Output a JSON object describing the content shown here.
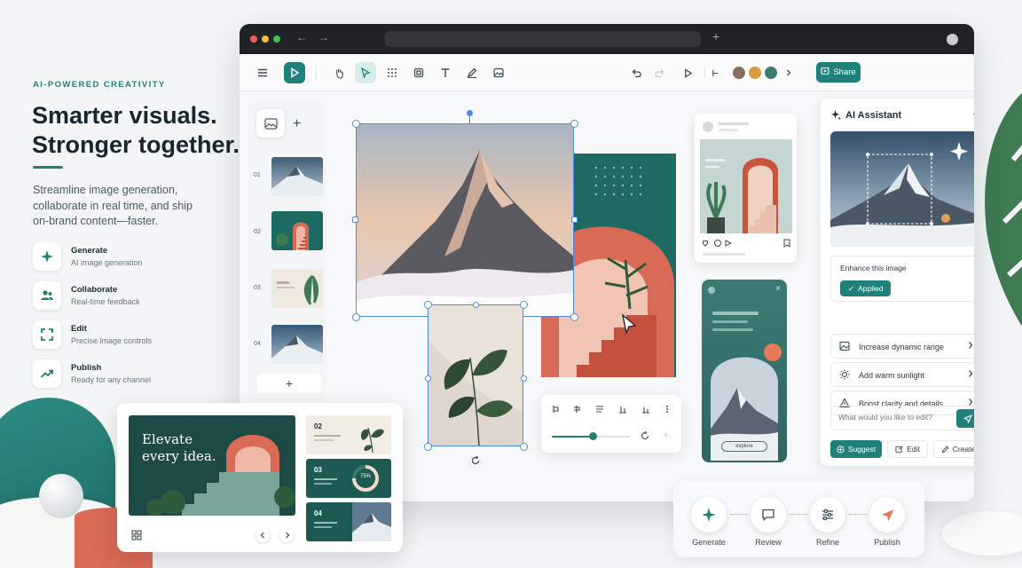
{
  "hero": {
    "eyebrow": "AI-POWERED CREATIVITY",
    "title_line1": "Smarter visuals.",
    "title_line2": "Stronger together.",
    "subtitle": "Streamline image generation, collaborate in real time, and ship on-brand content—faster."
  },
  "features": [
    {
      "title": "Generate",
      "desc": "AI image generation",
      "icon": "sparkle-icon"
    },
    {
      "title": "Collaborate",
      "desc": "Real-time feedback",
      "icon": "users-icon"
    },
    {
      "title": "Edit",
      "desc": "Precise image controls",
      "icon": "crop-frame-icon"
    },
    {
      "title": "Publish",
      "desc": "Ready for any channel",
      "icon": "trend-up-icon"
    }
  ],
  "toolbar": {
    "share_label": "Share"
  },
  "pages": [
    {
      "num": "01"
    },
    {
      "num": "02"
    },
    {
      "num": "03"
    },
    {
      "num": "04"
    }
  ],
  "canvas": {
    "story_button": "explore"
  },
  "ai_panel": {
    "title": "AI Assistant",
    "enhance_label": "Enhance this image",
    "applied_label": "Applied",
    "options": [
      {
        "label": "Increase dynamic range",
        "icon": "image-adjust-icon"
      },
      {
        "label": "Add warm sunlight",
        "icon": "sun-icon"
      },
      {
        "label": "Boost clarity and details",
        "icon": "triangle-icon"
      }
    ],
    "input_placeholder": "What would you like to edit?",
    "actions": {
      "suggest": "Suggest",
      "edit": "Edit",
      "create": "Create"
    }
  },
  "deck": {
    "hero_title": "Elevate every idea.",
    "slides": [
      {
        "num": "02"
      },
      {
        "num": "03"
      },
      {
        "num": "04"
      }
    ],
    "chart_label": "75%"
  },
  "workflow": [
    {
      "label": "Generate",
      "icon": "sparkle-icon"
    },
    {
      "label": "Review",
      "icon": "comment-icon"
    },
    {
      "label": "Refine",
      "icon": "sliders-icon"
    },
    {
      "label": "Publish",
      "icon": "send-icon"
    }
  ],
  "colors": {
    "accent": "#1f8179",
    "coral": "#d96a55",
    "selection": "#4b8de0"
  }
}
